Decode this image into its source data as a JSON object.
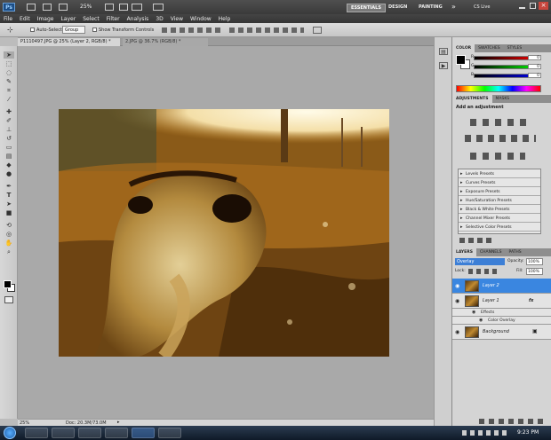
{
  "app": {
    "logo": "Ps",
    "zoom": "25%",
    "workspaces": [
      "ESSENTIALS",
      "DESIGN",
      "PAINTING"
    ],
    "more": "»",
    "cs_live": "CS Live"
  },
  "menu": [
    "File",
    "Edit",
    "Image",
    "Layer",
    "Select",
    "Filter",
    "Analysis",
    "3D",
    "View",
    "Window",
    "Help"
  ],
  "options": {
    "auto_select_label": "Auto-Select:",
    "auto_select_value": "Group",
    "show_transform": "Show Transform Controls"
  },
  "doc_tabs": [
    {
      "label": "P1110497.JPG @ 25% (Layer 2, RGB/8) *"
    },
    {
      "label": "2.JPG @ 36.7% (RGB/8) *"
    }
  ],
  "status": {
    "zoom": "25%",
    "doc": "Doc: 20.3M/73.0M"
  },
  "color_panel": {
    "tabs": [
      "COLOR",
      "SWATCHES",
      "STYLES"
    ],
    "channels": [
      {
        "label": "R",
        "value": "0"
      },
      {
        "label": "G",
        "value": "0"
      },
      {
        "label": "B",
        "value": "0"
      }
    ]
  },
  "adjust_panel": {
    "tabs": [
      "ADJUSTMENTS",
      "MASKS"
    ],
    "heading": "Add an adjustment",
    "presets": [
      "Levels Presets",
      "Curves Presets",
      "Exposure Presets",
      "Hue/Saturation Presets",
      "Black & White Presets",
      "Channel Mixer Presets",
      "Selective Color Presets"
    ]
  },
  "layers_panel": {
    "tabs": [
      "LAYERS",
      "CHANNELS",
      "PATHS"
    ],
    "blend_mode": "Overlay",
    "opacity_label": "Opacity:",
    "opacity": "100%",
    "lock_label": "Lock:",
    "fill_label": "Fill:",
    "fill": "100%",
    "layers": [
      {
        "name": "Layer 2",
        "selected": true
      },
      {
        "name": "Layer 1",
        "fx": "fx"
      },
      {
        "name": "Effects",
        "sub": true
      },
      {
        "name": "Color Overlay",
        "sub": true
      },
      {
        "name": "Background"
      }
    ]
  },
  "clock": "9:23 PM",
  "colors": {
    "accent": "#3d7fd6",
    "selected_layer": "#3a86e0"
  }
}
